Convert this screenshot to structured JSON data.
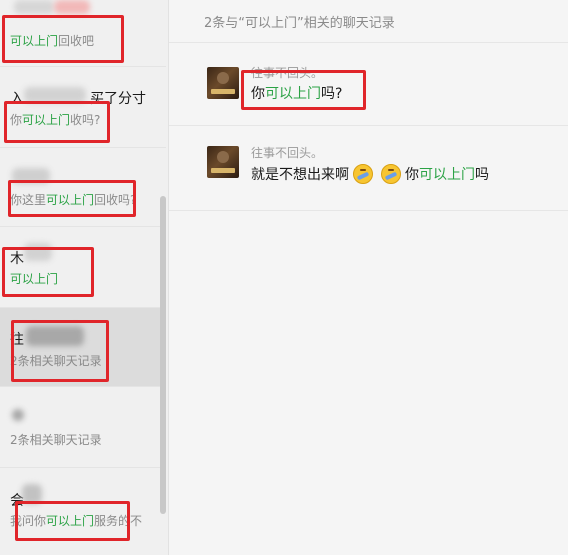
{
  "search": {
    "header": "2条与“可以上门”相关的聊天记录",
    "keyword": "可以上门"
  },
  "contacts": [
    {
      "name": "",
      "snippet_pre": "",
      "snippet_hl": "可以上门",
      "snippet_post": "回收吧"
    },
    {
      "name": "入",
      "name_tail": "买了分寸",
      "snippet_pre": "你",
      "snippet_hl": "可以上门",
      "snippet_post": "收吗?"
    },
    {
      "name": "",
      "snippet_pre": "你这里",
      "snippet_hl": "可以上门",
      "snippet_post": "回收吗?"
    },
    {
      "name": "木",
      "snippet_pre": "",
      "snippet_hl": "可以上门",
      "snippet_post": ""
    },
    {
      "name": "往",
      "snippet_pre": "2条相关聊天记录",
      "snippet_hl": "",
      "snippet_post": ""
    },
    {
      "name": "",
      "snippet_pre": "2条相关聊天记录",
      "snippet_hl": "",
      "snippet_post": ""
    },
    {
      "name": "会",
      "snippet_pre": "我问你",
      "snippet_hl": "可以上门",
      "snippet_post": "服务的不"
    }
  ],
  "messages": [
    {
      "sender": "往事不回头。",
      "pre": "你",
      "hl": "可以上门",
      "post": "吗?"
    },
    {
      "sender": "往事不回头。",
      "pre": "就是不想出来啊",
      "mid": "你",
      "hl": "可以上门",
      "post": "吗"
    }
  ],
  "colors": {
    "highlight": "#2ba245",
    "annotation": "#e0252a",
    "active_item": "#dcdcdc"
  }
}
